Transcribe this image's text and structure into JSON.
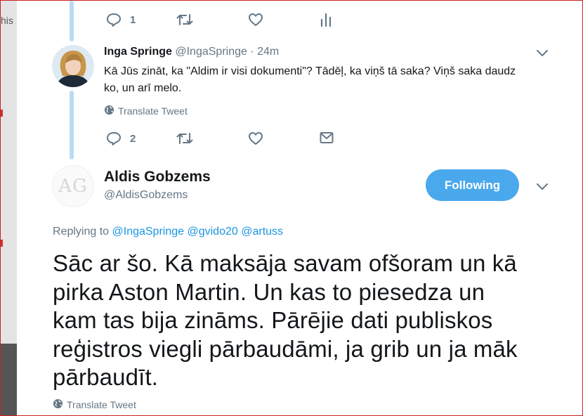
{
  "left_edge": {
    "partial_text": "his"
  },
  "top_actions": {
    "reply_count": "1"
  },
  "reply_tweet": {
    "author_name": "Inga Springe",
    "author_handle": "@IngaSpringe",
    "separator": "·",
    "time": "24m",
    "text_line1": "Kā Jūs zināt, ka \"Aldim ir visi dokumenti\"? Tādēļ, ka viņš tā saka? Viņš saka daudz",
    "text_line2": "ko, un arī melo.",
    "translate_label": "Translate Tweet",
    "reply_count": "2"
  },
  "main_tweet": {
    "avatar_initials": "AG",
    "author_name": "Aldis Gobzems",
    "author_handle": "@AldisGobzems",
    "follow_label": "Following",
    "replying_prefix": "Replying to",
    "replying_to": [
      "@IngaSpringe",
      "@gvido20",
      "@artuss"
    ],
    "text_lines": [
      "Sāc ar šo. Kā maksāja savam ofšoram un kā",
      "pirka Aston Martin. Un kas to piesedza un",
      "kam tas bija zināms. Pārējie dati publiskos",
      "reģistros viegli pārbaudāmi, ja grib un ja māk",
      "pārbaudīt."
    ],
    "translate_label": "Translate Tweet"
  },
  "colors": {
    "accent": "#1b95e0",
    "follow_button": "#4aa8ec",
    "thread_line": "#b8dcf6",
    "muted": "#657786"
  }
}
